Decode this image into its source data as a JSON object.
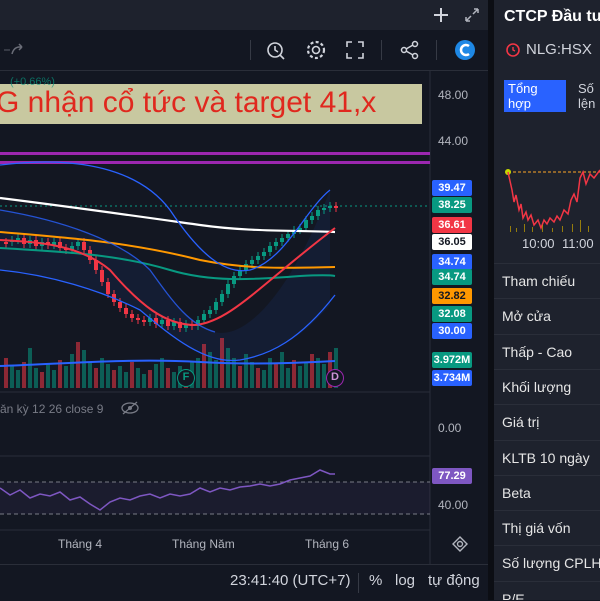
{
  "toolbar": {},
  "chart": {
    "pct_label": "(+0.66%)",
    "annotation": "G nhận cổ tức và target 41,x",
    "markers": {
      "f": "F",
      "d": "D"
    },
    "y_axis": [
      "48.00",
      "44.00",
      "40.00"
    ],
    "price_tags": [
      {
        "value": "39.47",
        "bg": "#2962ff",
        "fg": "#ffffff"
      },
      {
        "value": "38.25",
        "bg": "#089981",
        "fg": "#ffffff"
      },
      {
        "value": "36.61",
        "bg": "#f23645",
        "fg": "#ffffff"
      },
      {
        "value": "36.05",
        "bg": "#ffffff",
        "fg": "#131722"
      },
      {
        "value": "34.74",
        "bg": "#2962ff",
        "fg": "#ffffff"
      },
      {
        "value": "34.74",
        "bg": "#089981",
        "fg": "#ffffff"
      },
      {
        "value": "32.82",
        "bg": "#ff9800",
        "fg": "#131722"
      },
      {
        "value": "32.08",
        "bg": "#089981",
        "fg": "#ffffff"
      },
      {
        "value": "30.00",
        "bg": "#2962ff",
        "fg": "#ffffff"
      }
    ],
    "volume_tags": [
      {
        "value": "3.972M",
        "bg": "#089981",
        "fg": "#ffffff"
      },
      {
        "value": "3.734M",
        "bg": "#2962ff",
        "fg": "#ffffff"
      }
    ],
    "macd": {
      "legend": "ǎn kỳ 12 26 close 9",
      "value": "0.00"
    },
    "rsi": {
      "tag": "77.29",
      "level": "40.00"
    },
    "x_axis": [
      "Tháng 4",
      "Tháng Năm",
      "Tháng 6"
    ]
  },
  "bottombar": {
    "time": "23:41:40 (UTC+7)",
    "percent": "%",
    "log": "log",
    "auto": "tự động"
  },
  "panel": {
    "company": "CTCP Đầu tư",
    "ticker": "NLG:HSX",
    "tab_active": [
      "Tổng",
      "hợp"
    ],
    "tab_other": [
      "Số",
      "lện"
    ],
    "mini_x": [
      "10:00",
      "11:00"
    ],
    "rows": [
      "Tham chiếu",
      "Mở cửa",
      "Thấp - Cao",
      "Khối lượng",
      "Giá trị",
      "KLTB 10 ngày",
      "Beta",
      "Thị giá vốn",
      "Số lượng CPLH",
      "P/E"
    ]
  },
  "colors": {
    "bg": "#131722",
    "panel": "#1e222d",
    "up": "#089981",
    "down": "#f23645",
    "accent": "#2962ff",
    "purple": "#9c27b0",
    "annotation_bg": "#c8c8a0",
    "annotation_fg": "#e0281e"
  }
}
